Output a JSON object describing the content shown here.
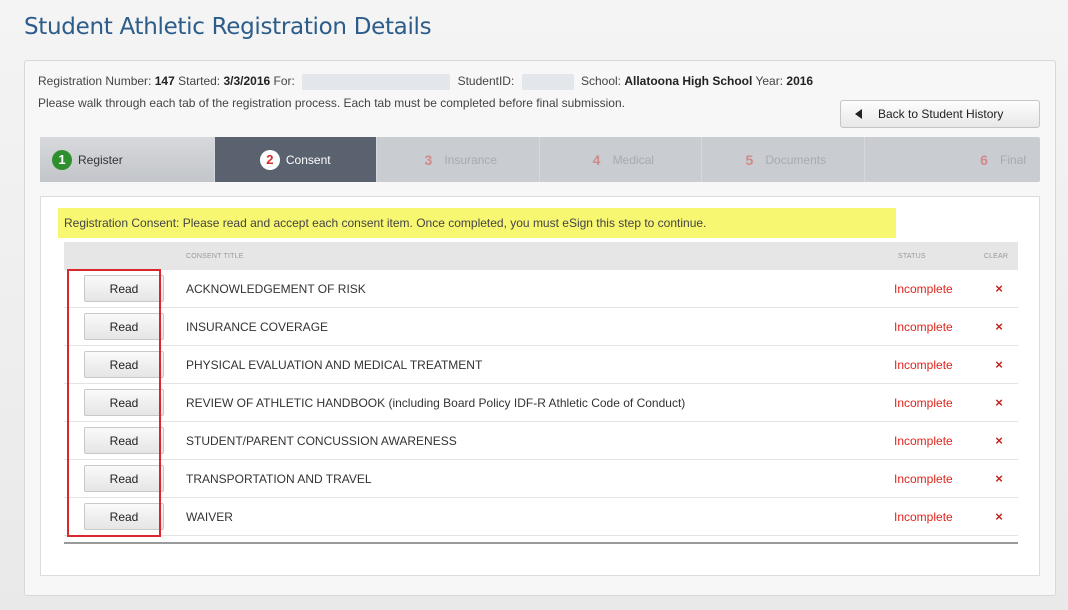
{
  "page": {
    "title": "Student Athletic Registration Details"
  },
  "registration": {
    "number_label": "Registration Number:",
    "number": "147",
    "started_label": "Started:",
    "started": "3/3/2016",
    "for_label": "For:",
    "student_id_label": "StudentID:",
    "school_label": "School:",
    "school": "Allatoona High School",
    "year_label": "Year:",
    "year": "2016",
    "instructions": "Please walk through each tab of the registration process. Each tab must be completed before final submission."
  },
  "back_button": {
    "label": "Back to Student History"
  },
  "tabs": [
    {
      "num": "1",
      "label": "Register"
    },
    {
      "num": "2",
      "label": "Consent"
    },
    {
      "num": "3",
      "label": "Insurance"
    },
    {
      "num": "4",
      "label": "Medical"
    },
    {
      "num": "5",
      "label": "Documents"
    },
    {
      "num": "6",
      "label": "Final"
    }
  ],
  "notice": "Registration Consent: Please read and accept each consent item. Once completed, you must eSign this step to continue.",
  "table": {
    "headers": {
      "title": "Consent Title",
      "status": "Status",
      "clear": "Clear"
    },
    "rows": [
      {
        "button": "Read",
        "title": "ACKNOWLEDGEMENT OF RISK",
        "status": "Incomplete",
        "clear": "×"
      },
      {
        "button": "Read",
        "title": "INSURANCE COVERAGE",
        "status": "Incomplete",
        "clear": "×"
      },
      {
        "button": "Read",
        "title": "PHYSICAL EVALUATION AND MEDICAL TREATMENT",
        "status": "Incomplete",
        "clear": "×"
      },
      {
        "button": "Read",
        "title": "REVIEW OF ATHLETIC HANDBOOK (including Board Policy IDF-R Athletic Code of Conduct)",
        "status": "Incomplete",
        "clear": "×"
      },
      {
        "button": "Read",
        "title": "STUDENT/PARENT CONCUSSION AWARENESS",
        "status": "Incomplete",
        "clear": "×"
      },
      {
        "button": "Read",
        "title": "TRANSPORTATION AND TRAVEL",
        "status": "Incomplete",
        "clear": "×"
      },
      {
        "button": "Read",
        "title": "WAIVER",
        "status": "Incomplete",
        "clear": "×"
      }
    ]
  }
}
